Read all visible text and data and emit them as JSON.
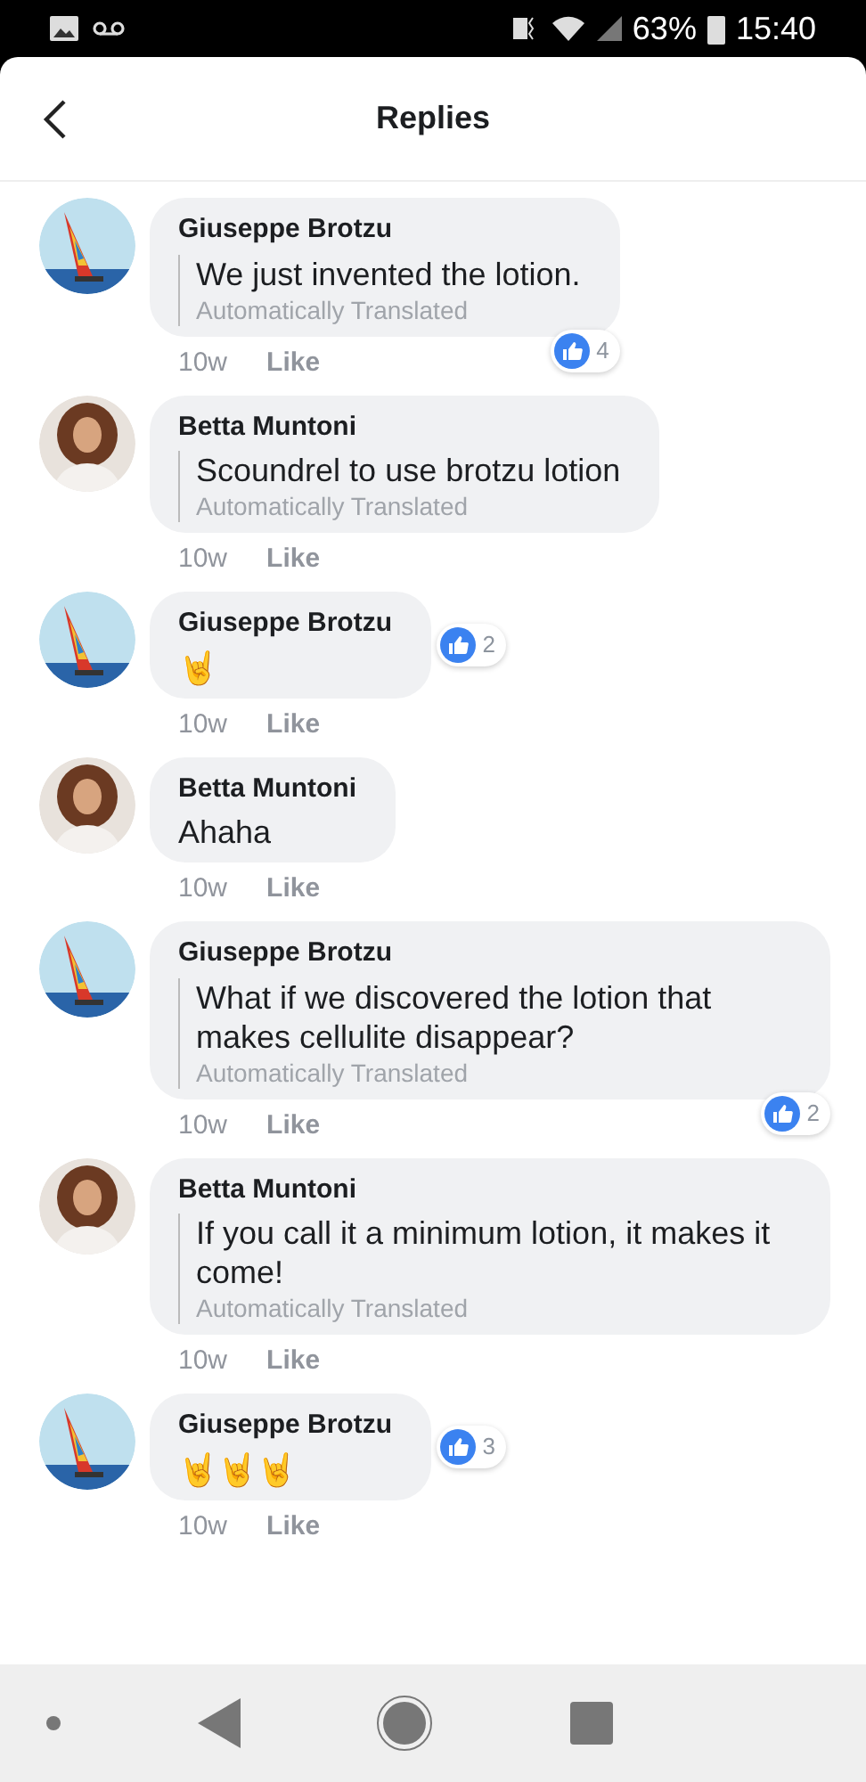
{
  "status_bar": {
    "battery": "63%",
    "time": "15:40"
  },
  "header": {
    "title": "Replies"
  },
  "comments": [
    {
      "author": "Giuseppe Brotzu",
      "text": "We just invented the lotion.",
      "translation": "Automatically Translated",
      "time": "10w",
      "like": "Like",
      "likes": "4"
    },
    {
      "author": "Betta Muntoni",
      "text": "Scoundrel to use brotzu lotion",
      "translation": "Automatically Translated",
      "time": "10w",
      "like": "Like"
    },
    {
      "author": "Giuseppe Brotzu",
      "text": "🤘",
      "time": "10w",
      "like": "Like",
      "likes": "2"
    },
    {
      "author": "Betta Muntoni",
      "text": "Ahaha",
      "time": "10w",
      "like": "Like"
    },
    {
      "author": "Giuseppe Brotzu",
      "text": "What if we discovered the lotion that makes cellulite disappear?",
      "translation": "Automatically Translated",
      "time": "10w",
      "like": "Like",
      "likes": "2"
    },
    {
      "author": "Betta Muntoni",
      "text": "If you call it a minimum lotion, it makes it come!",
      "translation": "Automatically Translated",
      "time": "10w",
      "like": "Like"
    },
    {
      "author": "Giuseppe Brotzu",
      "text": "🤘🤘🤘",
      "time": "10w",
      "like": "Like",
      "likes": "3"
    }
  ]
}
